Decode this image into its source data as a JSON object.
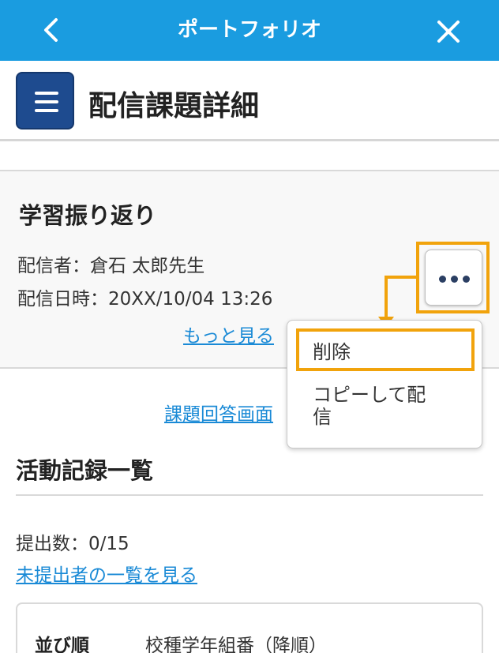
{
  "topbar": {
    "title": "ポートフォリオ",
    "back_icon": "chevron-left-icon",
    "close_icon": "close-icon",
    "bg_color": "#1a9ce0"
  },
  "header": {
    "page_title": "配信課題詳細",
    "menu_icon": "hamburger-menu-icon"
  },
  "assignment": {
    "title": "学習振り返り",
    "sender": "配信者：倉石 太郎先生",
    "datetime": "配信日時：20XX/10/04 13:26",
    "more_link": "もっと見る"
  },
  "more_menu": {
    "icon": "more-dots-icon",
    "items": [
      {
        "label": "削除"
      },
      {
        "label": "コピーして配\n信"
      }
    ],
    "highlight_color": "#f1a30c"
  },
  "answer_link": "課題回答画面",
  "activity": {
    "title": "活動記録一覧",
    "submit_count": "提出数：0/15",
    "unsubmitted_link": "未提出者の一覧を見る",
    "sort_label": "並び順",
    "sort_value": "校種学年組番（降順）"
  }
}
